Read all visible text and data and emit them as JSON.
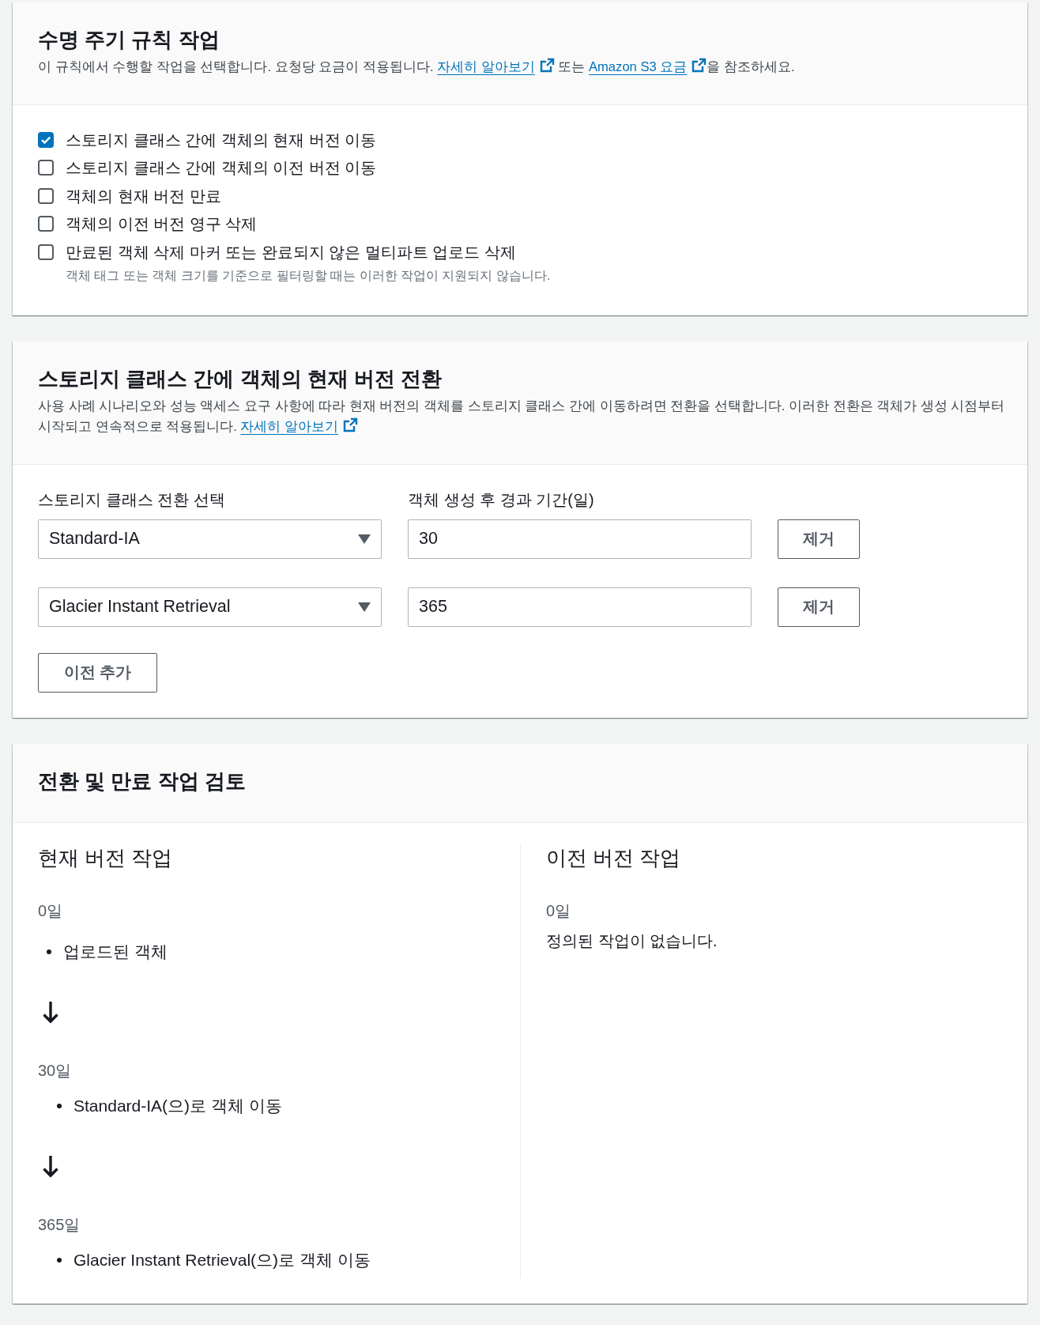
{
  "actions_panel": {
    "title": "수명 주기 규칙 작업",
    "description": [
      {
        "kind": "text",
        "text": "이 규칙에서 수행할 작업을 선택합니다. 요청당 요금이 적용됩니다. "
      },
      {
        "kind": "link",
        "text": "자세히 알아보기"
      },
      {
        "kind": "text",
        "text": " 또는 "
      },
      {
        "kind": "link",
        "text": "Amazon S3 요금"
      },
      {
        "kind": "text",
        "text": "을 참조하세요."
      }
    ],
    "options": [
      {
        "label": "스토리지 클래스 간에 객체의 현재 버전 이동",
        "checked": true
      },
      {
        "label": "스토리지 클래스 간에 객체의 이전 버전 이동",
        "checked": false
      },
      {
        "label": "객체의 현재 버전 만료",
        "checked": false
      },
      {
        "label": "객체의 이전 버전 영구 삭제",
        "checked": false
      },
      {
        "label": "만료된 객체 삭제 마커 또는 완료되지 않은 멀티파트 업로드 삭제",
        "checked": false,
        "hint": "객체 태그 또는 객체 크기를 기준으로 필터링할 때는 이러한 작업이 지원되지 않습니다."
      }
    ]
  },
  "transitions_panel": {
    "title": "스토리지 클래스 간에 객체의 현재 버전 전환",
    "description": [
      {
        "kind": "text",
        "text": "사용 사례 시나리오와 성능 액세스 요구 사항에 따라 현재 버전의 객체를 스토리지 클래스 간에 이동하려면 전환을 선택합니다. 이러한 전환은 객체가 생성 시점부터 시작되고 연속적으로 적용됩니다. "
      },
      {
        "kind": "link",
        "text": "자세히 알아보기"
      }
    ],
    "columns": [
      "스토리지 클래스 전환 선택",
      "객체 생성 후 경과 기간(일)"
    ],
    "rows": [
      {
        "storage_class": "Standard-IA",
        "days": "30",
        "remove_button": "제거"
      },
      {
        "storage_class": "Glacier Instant Retrieval",
        "days": "365",
        "remove_button": "제거"
      }
    ],
    "add_button": "이전 추가"
  },
  "review_panel": {
    "title": "전환 및 만료 작업 검토",
    "columns": [
      {
        "title": "현재 버전 작업",
        "steps": [
          {
            "kind": "start",
            "day": "0일",
            "text": "업로드된 객체"
          },
          {
            "kind": "transition",
            "day": "30일",
            "text": "Standard-IA(으)로 객체 이동"
          },
          {
            "kind": "transition",
            "day": "365일",
            "text": "Glacier Instant Retrieval(으)로 객체 이동"
          }
        ]
      },
      {
        "title": "이전 버전 작업",
        "steps": [
          {
            "kind": "note",
            "day": "0일",
            "text": "정의된 작업이 없습니다."
          }
        ]
      }
    ]
  }
}
